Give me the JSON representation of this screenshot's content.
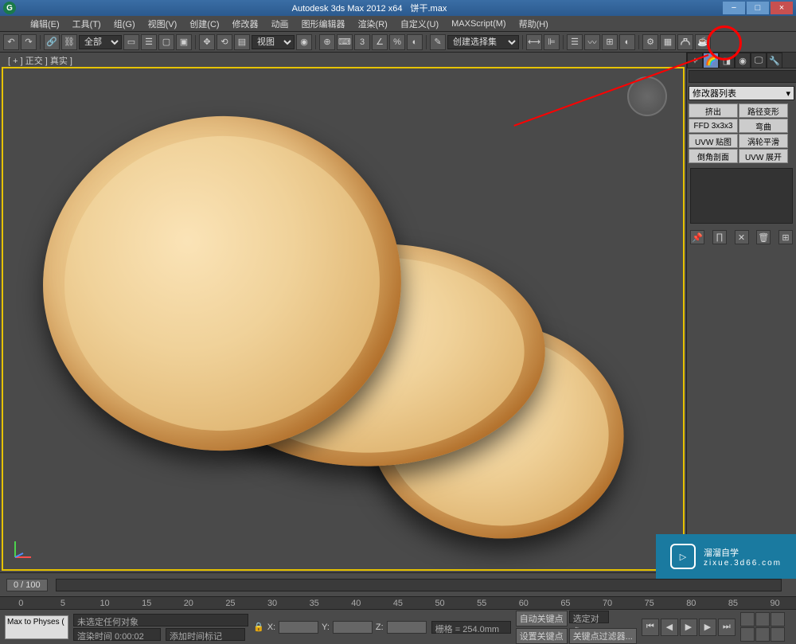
{
  "app": {
    "title": "Autodesk 3ds Max 2012 x64",
    "filename": "饼干.max"
  },
  "menu": [
    "编辑(E)",
    "工具(T)",
    "组(G)",
    "视图(V)",
    "创建(C)",
    "修改器",
    "动画",
    "图形编辑器",
    "渲染(R)",
    "自定义(U)",
    "MAXScript(M)",
    "帮助(H)"
  ],
  "toolbar": {
    "filter_dd": "全部",
    "view_dd": "视图",
    "selset_dd": "创建选择集"
  },
  "viewport": {
    "label": "[ + ] 正交 ] 真实 ]"
  },
  "right": {
    "name_field": "",
    "modifier_list_label": "修改器列表",
    "modifiers": [
      {
        "l": "挤出",
        "r": "路径变形"
      },
      {
        "l": "FFD 3x3x3",
        "r": "弯曲"
      },
      {
        "l": "UVW 贴图",
        "r": "涡轮平滑"
      },
      {
        "l": "倒角剖面",
        "r": "UVW 展开"
      }
    ]
  },
  "timeline": {
    "range": "0 / 100",
    "ticks": [
      "0",
      "5",
      "10",
      "15",
      "20",
      "25",
      "30",
      "35",
      "40",
      "45",
      "50",
      "55",
      "60",
      "65",
      "70",
      "75",
      "80",
      "85",
      "90"
    ]
  },
  "status": {
    "script_label": "Max to Physes (",
    "sel_status": "未选定任何对象",
    "render_time": "渲染时间   0:00:02",
    "add_time_tag": "添加时间标记",
    "x_label": "X:",
    "y_label": "Y:",
    "z_label": "Z:",
    "grid": "栅格 = 254.0mm",
    "auto_key": "自动关键点",
    "sel_obj": "选定对象",
    "set_key": "设置关键点",
    "key_filter": "关键点过滤器..."
  },
  "watermark": {
    "title": "溜溜自学",
    "sub": "zixue.3d66.com"
  }
}
